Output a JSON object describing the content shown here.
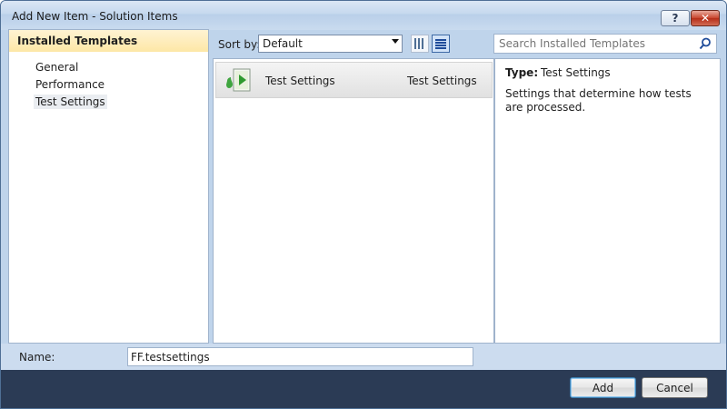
{
  "window": {
    "title": "Add New Item - Solution Items",
    "help_glyph": "?",
    "close_glyph": "✕"
  },
  "sidebar": {
    "header": "Installed Templates",
    "items": [
      {
        "label": "General"
      },
      {
        "label": "Performance"
      },
      {
        "label": "Test Settings",
        "selected": true
      }
    ]
  },
  "toolbar": {
    "sort_label": "Sort by:",
    "sort_value": "Default",
    "view_buttons": [
      "medium-icons-view-icon",
      "details-view-icon"
    ]
  },
  "search": {
    "placeholder": "Search Installed Templates",
    "icon": "search-icon"
  },
  "templates": [
    {
      "name": "Test Settings",
      "category": "Test Settings",
      "icon": "test-settings-icon",
      "selected": true
    }
  ],
  "details": {
    "type_label": "Type:",
    "type_value": "Test Settings",
    "description": "Settings that determine how tests are processed."
  },
  "name_field": {
    "label": "Name:",
    "value": "FF.testsettings"
  },
  "buttons": {
    "add": "Add",
    "cancel": "Cancel"
  },
  "colors": {
    "window_bg": "#bfd4eb",
    "header_highlight": "#fde7a6",
    "footer_bg": "#2b3b55",
    "selected_item": "#e1e1e1"
  }
}
